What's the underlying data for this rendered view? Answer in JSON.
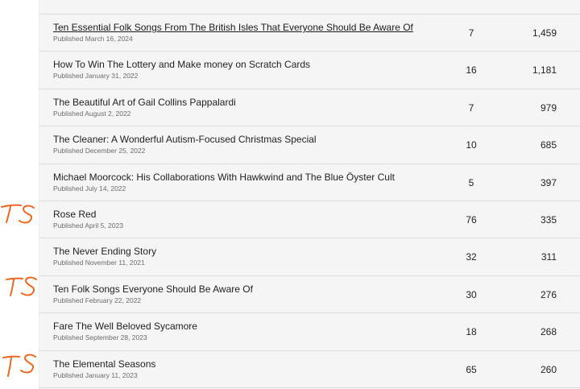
{
  "posts": [
    {
      "title": "Ten Essential Folk Songs From The British Isles That Everyone Should Be Aware Of",
      "date": "Published March 16, 2024",
      "count": "7",
      "views": "1,459"
    },
    {
      "title": "How To Win The Lottery and Make money on Scratch Cards",
      "date": "Published January 31, 2022",
      "count": "16",
      "views": "1,181"
    },
    {
      "title": "The Beautiful Art of Gail Collins Pappalardi",
      "date": "Published August 2, 2022",
      "count": "7",
      "views": "979"
    },
    {
      "title": "The Cleaner: A Wonderful Autism-Focused Christmas Special",
      "date": "Published December 25, 2022",
      "count": "10",
      "views": "685"
    },
    {
      "title": "Michael Moorcock: His Collaborations With Hawkwind and The Blue Öyster Cult",
      "date": "Published July 14, 2022",
      "count": "5",
      "views": "397"
    },
    {
      "title": "Rose Red",
      "date": "Published April 5, 2023",
      "count": "76",
      "views": "335"
    },
    {
      "title": "The Never Ending Story",
      "date": "Published November 11, 2021",
      "count": "32",
      "views": "311"
    },
    {
      "title": "Ten Folk Songs Everyone Should Be Aware Of",
      "date": "Published February 22, 2022",
      "count": "30",
      "views": "276"
    },
    {
      "title": "Fare The Well Beloved Sycamore",
      "date": "Published September 28, 2023",
      "count": "18",
      "views": "268"
    },
    {
      "title": "The Elemental Seasons",
      "date": "Published January 11, 2023",
      "count": "65",
      "views": "260"
    }
  ],
  "annotations": {
    "mark_text": "TS",
    "color": "#f0651f"
  },
  "colors": {
    "panel": "#f5f5f5",
    "divider": "#dedede",
    "text": "#222222",
    "muted": "#6b6b6b"
  }
}
